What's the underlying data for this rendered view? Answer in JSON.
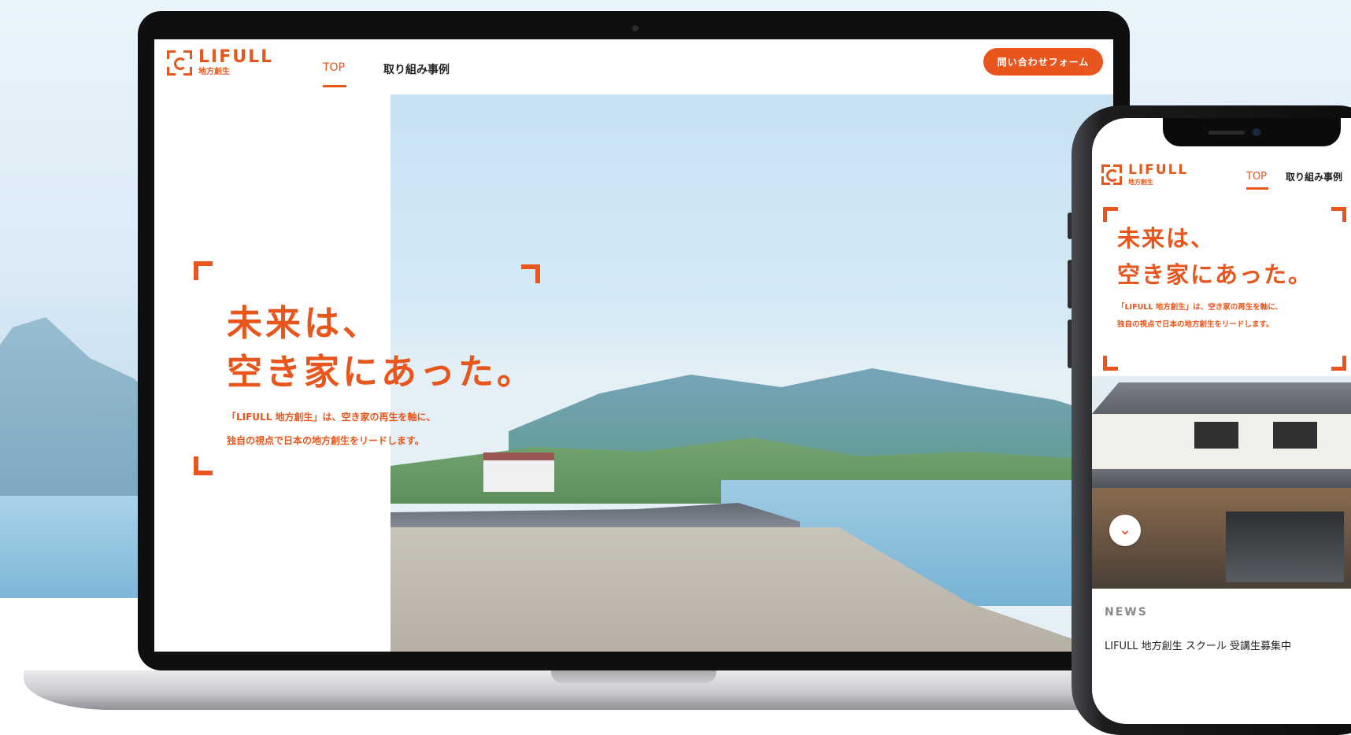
{
  "brand": {
    "name": "LIFULL",
    "tagline": "地方創生",
    "accent_color": "#e8561d"
  },
  "desktop": {
    "nav": {
      "top_label": "TOP",
      "cases_label": "取り組み事例",
      "contact_button": "問い合わせフォーム"
    },
    "hero": {
      "headline_line1": "未来は、",
      "headline_line2": "空き家にあった。",
      "sub_line1": "「LIFULL 地方創生」は、空き家の再生を軸に、",
      "sub_line2": "独自の視点で日本の地方創生をリードします。"
    }
  },
  "mobile": {
    "nav": {
      "top_label": "TOP",
      "cases_label": "取り組み事例"
    },
    "hero": {
      "headline_line1": "未来は、",
      "headline_line2": "空き家にあった。",
      "sub_line1": "「LIFULL 地方創生」は、空き家の再生を軸に、",
      "sub_line2": "独自の視点で日本の地方創生をリードします。"
    },
    "scroll_icon": "chevron-down-icon",
    "news": {
      "heading": "NEWS",
      "first_item": "LIFULL 地方創生 スクール 受講生募集中"
    }
  }
}
